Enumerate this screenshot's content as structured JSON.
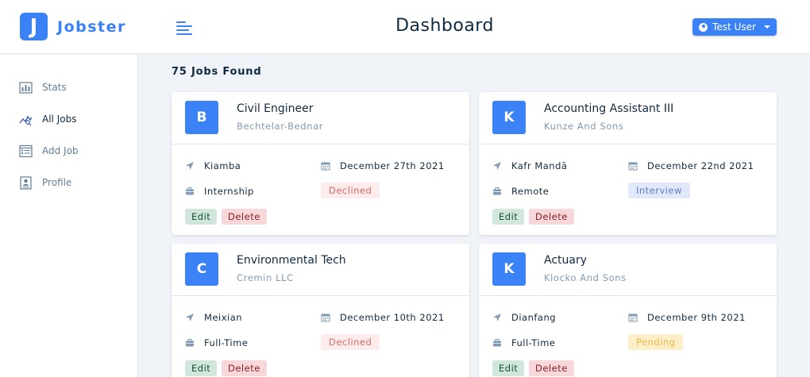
{
  "app": {
    "logo_letter": "J",
    "logo_name": "Jobster"
  },
  "header": {
    "title": "Dashboard",
    "user_label": "Test User"
  },
  "sidebar": {
    "items": [
      {
        "label": "Stats",
        "icon": "bar-chart-icon"
      },
      {
        "label": "All Jobs",
        "icon": "line-chart-icon"
      },
      {
        "label": "Add Job",
        "icon": "form-icon"
      },
      {
        "label": "Profile",
        "icon": "id-card-icon"
      }
    ]
  },
  "jobs": {
    "count_label": "75 Jobs Found",
    "edit_label": "Edit",
    "delete_label": "Delete",
    "list": [
      {
        "letter": "B",
        "position": "Civil Engineer",
        "company": "Bechtelar-Bednar",
        "location": "Kiamba",
        "date": "December 27th 2021",
        "type": "Internship",
        "status": "Declined"
      },
      {
        "letter": "K",
        "position": "Accounting Assistant III",
        "company": "Kunze And Sons",
        "location": "Kafr Mandā",
        "date": "December 22nd 2021",
        "type": "Remote",
        "status": "Interview"
      },
      {
        "letter": "C",
        "position": "Environmental Tech",
        "company": "Cremin LLC",
        "location": "Meixian",
        "date": "December 10th 2021",
        "type": "Full-Time",
        "status": "Declined"
      },
      {
        "letter": "K",
        "position": "Actuary",
        "company": "Klocko And Sons",
        "location": "Dianfang",
        "date": "December 9th 2021",
        "type": "Full-Time",
        "status": "Pending"
      }
    ]
  },
  "colors": {
    "primary": "#3b82f6",
    "declined": "#d66a6a",
    "interview": "#647acb",
    "pending": "#e9b949"
  }
}
